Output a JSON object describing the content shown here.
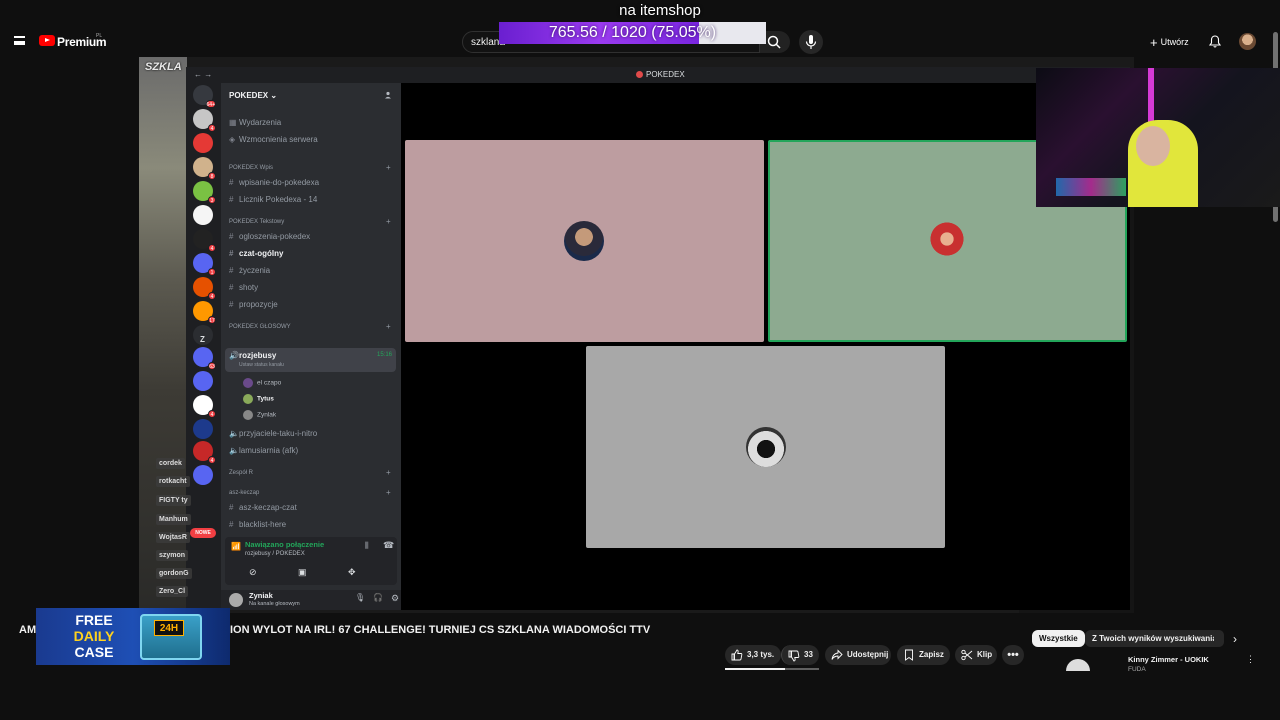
{
  "overlay": {
    "title": "na itemshop",
    "goal_text": "765.56 / 1020 (75.05%)",
    "goal_fraction": 0.7505
  },
  "youtube": {
    "brand": "Premium",
    "region": "PL",
    "search_value": "szklana",
    "create_label": "Utwórz"
  },
  "chat_overlay": {
    "names": [
      "cordek",
      "rotkacht",
      "FIGTY ty",
      "Manhum",
      "WojtasR",
      "szymon",
      "gordonG",
      "Zero_Cl"
    ]
  },
  "discord": {
    "window_title": "POKEDEX",
    "server_name": "POKEDEX",
    "server_badges": [
      "64+",
      "4",
      "8",
      "3",
      "4",
      "1",
      "4",
      "17",
      "63",
      "4",
      "4"
    ],
    "new_label": "NOWE",
    "top_items": [
      {
        "icon": "calendar-icon",
        "label": "Wydarzenia"
      },
      {
        "icon": "boost-icon",
        "label": "Wzmocnienia serwera"
      }
    ],
    "categories": [
      {
        "name": "POKEDEX Wpis",
        "channels": [
          "wpisanie-do-pokedexa",
          "Licznik Pokedexa - 14"
        ]
      },
      {
        "name": "POKEDEX Tekstowy",
        "channels": [
          "ogloszenia-pokedex",
          "czat-ogólny",
          "życzenia",
          "shoty",
          "propozycje"
        ]
      },
      {
        "name": "POKEDEX GŁOSOWY",
        "channels": [
          "rozjebusy",
          "przyjaciele-taku-i-nitro",
          "lamusiarnia (afk)"
        ]
      },
      {
        "name": "Zespół R",
        "channels": []
      },
      {
        "name": "asz-keczap",
        "channels": [
          "asz-keczap-czat",
          "blacklist-here",
          "mieyny-here"
        ]
      }
    ],
    "active_voice": {
      "name": "rozjebusy",
      "status_hint": "Ustaw status kanału",
      "timer": "15:16",
      "members": [
        "el czapo",
        "Tytus",
        "Zynlak"
      ]
    },
    "connection": {
      "status": "Nawiązano połączenie",
      "location": "rozjebusy / POKEDEX"
    },
    "user": {
      "name": "Zyniak",
      "status": "Na kanale głosowym"
    },
    "tile_colors": [
      "#bd9da0",
      "#8daa90",
      "#a8a8a8"
    ],
    "accent": "#23a55a"
  },
  "video": {
    "title_prefix": "AM",
    "title": "ION WYLOT NA IRL! 67 CHALLENGE! TURNIEJ CS SZKLANA WIADOMOŚCI TTV",
    "promo_line1": "FREE",
    "promo_line2": "DAILY",
    "promo_line3": "CASE",
    "promo_badge": "24H",
    "actions": {
      "likes": "3,3 tys.",
      "dislikes": "33",
      "share": "Udostępnij",
      "save": "Zapisz",
      "clip": "Klip"
    }
  },
  "sidebar": {
    "chips": [
      "Wszystkie",
      "Z Twoich wyników wyszukiwania"
    ],
    "recommendation": {
      "title": "Kinny Zimmer - UOKIK",
      "channel": "FUDA"
    }
  }
}
